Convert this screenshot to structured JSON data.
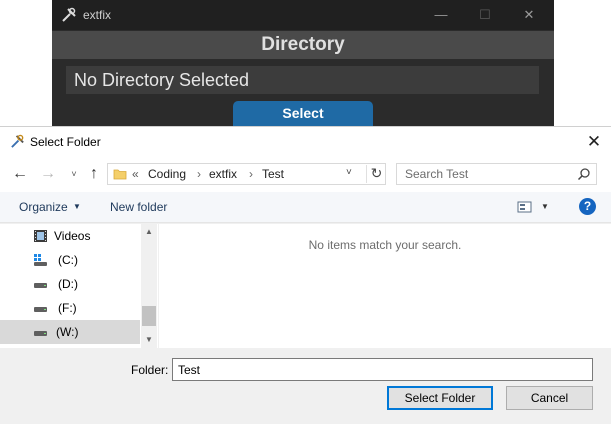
{
  "app": {
    "title": "extfix",
    "header": "Directory",
    "directory_value": "No Directory Selected",
    "select_label": "Select",
    "controls": {
      "minimize": "—",
      "maximize": "☐",
      "close": "✕"
    },
    "colors": {
      "background": "#2b2b2b",
      "header": "#4a4a4a",
      "accent": "#1f6aa5"
    }
  },
  "dialog": {
    "title": "Select Folder",
    "close_glyph": "✕",
    "nav": {
      "back": "←",
      "forward": "→",
      "recent": "˅",
      "up": "↑"
    },
    "breadcrumb": {
      "more": "«",
      "items": [
        "Coding",
        "extfix",
        "Test"
      ],
      "separator": "›",
      "dropdown": "˅",
      "refresh": "↻"
    },
    "search": {
      "placeholder": "Search Test",
      "value": ""
    },
    "toolbar": {
      "organize_label": "Organize",
      "organize_caret": "▼",
      "new_folder_label": "New folder",
      "view_caret": "▼",
      "help_label": "?"
    },
    "tree": [
      {
        "label": "Videos",
        "icon": "video-folder-icon",
        "selected": false
      },
      {
        "label": "(C:)",
        "icon": "windows-drive-icon",
        "selected": false
      },
      {
        "label": "(D:)",
        "icon": "drive-icon",
        "selected": false
      },
      {
        "label": "(F:)",
        "icon": "drive-icon",
        "selected": false
      },
      {
        "label": "(W:)",
        "icon": "drive-icon",
        "selected": true
      }
    ],
    "scroll": {
      "up": "▲",
      "down": "▼"
    },
    "empty_message": "No items match your search.",
    "folder_label": "Folder:",
    "folder_value": "Test",
    "select_folder_label": "Select Folder",
    "cancel_label": "Cancel",
    "colors": {
      "accent": "#0078d7",
      "help": "#1565c0",
      "link_text": "#1e395b"
    }
  }
}
